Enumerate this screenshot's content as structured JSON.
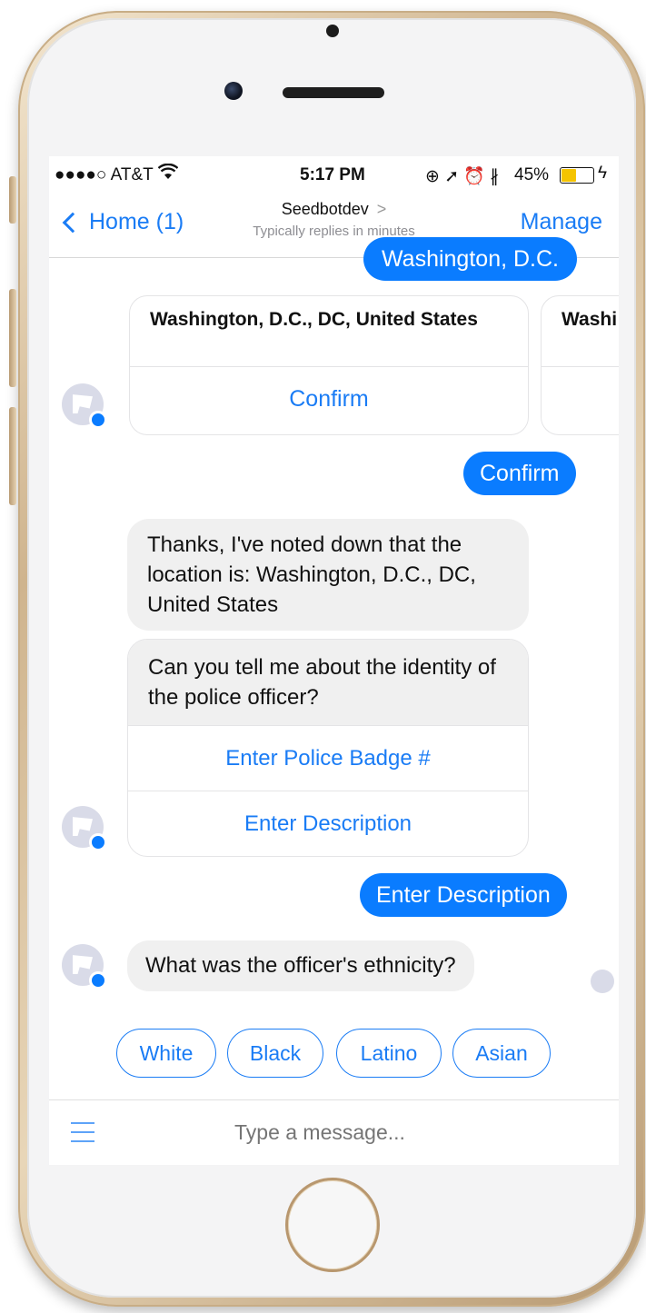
{
  "status_bar": {
    "carrier": "●●●●○ AT&T",
    "wifi_icon": "wifi",
    "time": "5:17 PM",
    "right_icons": "⊕ ➚ ⏰ ∦",
    "battery": "45%",
    "battery_level": 0.45
  },
  "nav": {
    "back_label": "Home (1)",
    "title": "Seedbotdev",
    "title_arrow": ">",
    "subtitle": "Typically replies in minutes",
    "manage_label": "Manage"
  },
  "messages": {
    "top_partial": "Washington, D.C.",
    "location_card": {
      "title": "Washington, D.C., DC, United States",
      "button": "Confirm",
      "next_card_title": "Washi"
    },
    "confirm_reply": "Confirm",
    "bot_thanks": "Thanks, I've noted down that the location is: Washington, D.C., DC, United States",
    "identity_question": "Can you tell me about the identity of the police officer?",
    "identity_buttons": [
      "Enter Police Badge #",
      "Enter Description"
    ],
    "description_reply": "Enter Description",
    "ethnicity_question": "What was the officer's ethnicity?"
  },
  "quick_replies": [
    "White",
    "Black",
    "Latino",
    "Asian"
  ],
  "composer": {
    "placeholder": "Type a message..."
  },
  "colors": {
    "accent": "#1a7cf5",
    "outgoing_bubble": "#0a7cff",
    "incoming_bubble": "#f0f0f0",
    "phone_frame": "#cfb48e"
  }
}
